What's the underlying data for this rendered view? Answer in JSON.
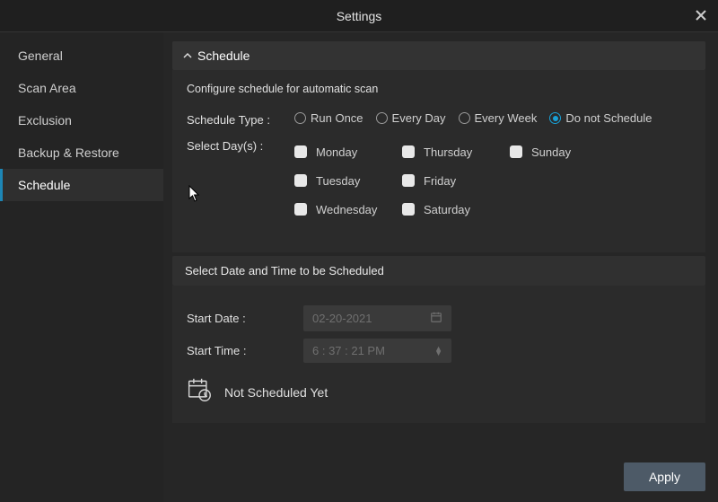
{
  "window": {
    "title": "Settings"
  },
  "sidebar": {
    "items": [
      {
        "label": "General"
      },
      {
        "label": "Scan Area"
      },
      {
        "label": "Exclusion"
      },
      {
        "label": "Backup & Restore"
      },
      {
        "label": "Schedule"
      }
    ],
    "active_index": 4
  },
  "schedule": {
    "panel_title": "Schedule",
    "subtitle": "Configure schedule for automatic scan",
    "type_label": "Schedule Type :",
    "types": [
      {
        "label": "Run Once",
        "selected": false
      },
      {
        "label": "Every Day",
        "selected": false
      },
      {
        "label": "Every Week",
        "selected": false
      },
      {
        "label": "Do not Schedule",
        "selected": true
      }
    ],
    "days_label": "Select Day(s) :",
    "days": [
      {
        "label": "Monday"
      },
      {
        "label": "Thursday"
      },
      {
        "label": "Sunday"
      },
      {
        "label": "Tuesday"
      },
      {
        "label": "Friday"
      },
      {
        "label": "Wednesday"
      },
      {
        "label": "Saturday"
      }
    ],
    "datetime_heading": "Select Date and Time to be Scheduled",
    "start_date_label": "Start Date :",
    "start_date_value": "02-20-2021",
    "start_time_label": "Start Time :",
    "start_time_value": "6  : 37 : 21  PM",
    "status_text": "Not Scheduled Yet"
  },
  "buttons": {
    "apply": "Apply"
  }
}
